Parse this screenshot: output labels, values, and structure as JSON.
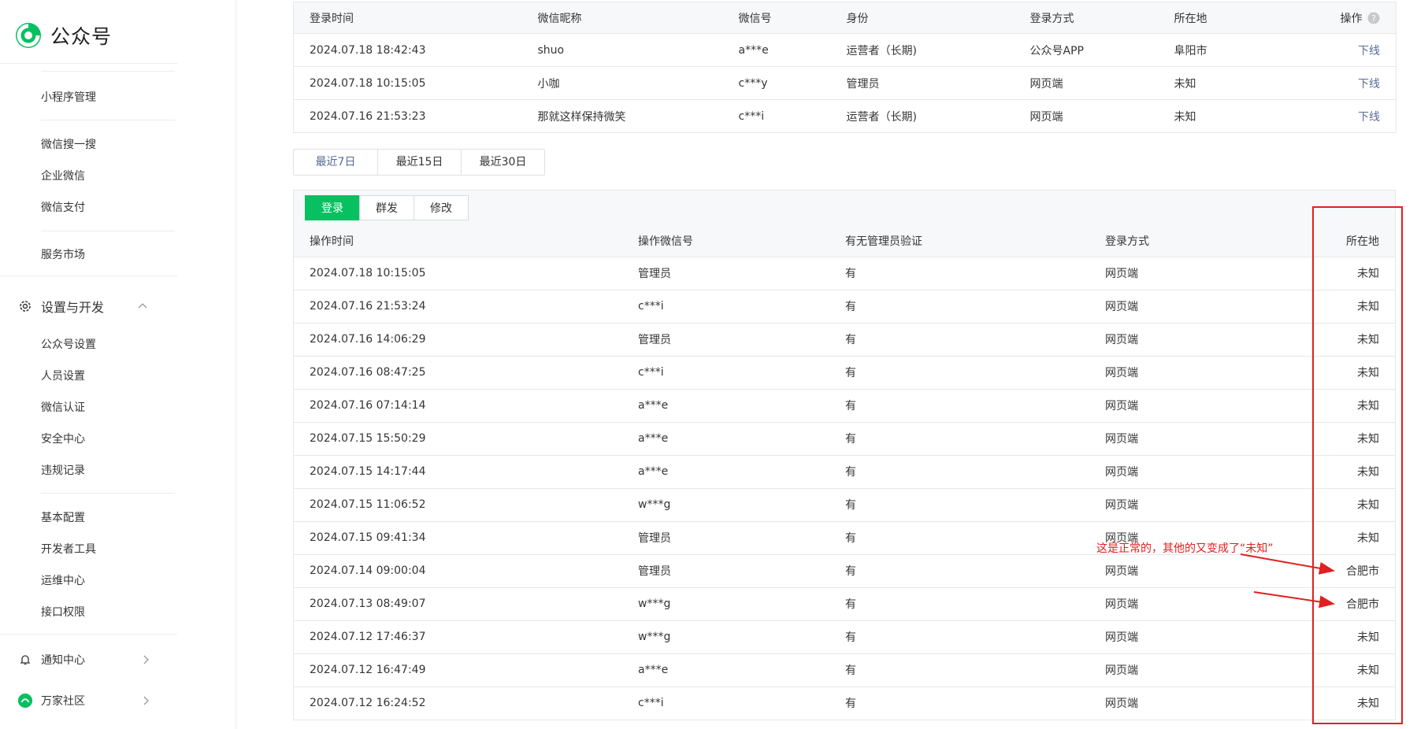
{
  "brand": {
    "title": "公众号"
  },
  "sidebar": {
    "items": [
      "小程序管理",
      "微信搜一搜",
      "企业微信",
      "微信支付",
      "服务市场"
    ],
    "settings": {
      "label": "设置与开发",
      "sub": [
        "公众号设置",
        "人员设置",
        "微信认证",
        "安全中心",
        "违规记录"
      ],
      "sub2": [
        "基本配置",
        "开发者工具",
        "运维中心",
        "接口权限"
      ]
    },
    "notify": "通知中心",
    "community": "万家社区"
  },
  "login_table": {
    "headers": [
      "登录时间",
      "微信昵称",
      "微信号",
      "身份",
      "登录方式",
      "所在地",
      "操作"
    ],
    "rows": [
      [
        "2024.07.18 18:42:43",
        "shuo",
        "a***e",
        "运营者（长期)",
        "公众号APP",
        "阜阳市",
        "下线"
      ],
      [
        "2024.07.18 10:15:05",
        "小咖",
        "c***y",
        "管理员",
        "网页端",
        "未知",
        "下线"
      ],
      [
        "2024.07.16 21:53:23",
        "那就这样保持微笑",
        "c***i",
        "运营者（长期)",
        "网页端",
        "未知",
        "下线"
      ]
    ]
  },
  "range_buttons": [
    "最近7日",
    "最近15日",
    "最近30日"
  ],
  "tabs": [
    "登录",
    "群发",
    "修改"
  ],
  "log_table": {
    "headers": [
      "操作时间",
      "操作微信号",
      "有无管理员验证",
      "登录方式",
      "所在地"
    ],
    "rows": [
      [
        "2024.07.18 10:15:05",
        "管理员",
        "有",
        "网页端",
        "未知"
      ],
      [
        "2024.07.16 21:53:24",
        "c***i",
        "有",
        "网页端",
        "未知"
      ],
      [
        "2024.07.16 14:06:29",
        "管理员",
        "有",
        "网页端",
        "未知"
      ],
      [
        "2024.07.16 08:47:25",
        "c***i",
        "有",
        "网页端",
        "未知"
      ],
      [
        "2024.07.16 07:14:14",
        "a***e",
        "有",
        "网页端",
        "未知"
      ],
      [
        "2024.07.15 15:50:29",
        "a***e",
        "有",
        "网页端",
        "未知"
      ],
      [
        "2024.07.15 14:17:44",
        "a***e",
        "有",
        "网页端",
        "未知"
      ],
      [
        "2024.07.15 11:06:52",
        "w***g",
        "有",
        "网页端",
        "未知"
      ],
      [
        "2024.07.15 09:41:34",
        "管理员",
        "有",
        "网页端",
        "未知"
      ],
      [
        "2024.07.14 09:00:04",
        "管理员",
        "有",
        "网页端",
        "合肥市"
      ],
      [
        "2024.07.13 08:49:07",
        "w***g",
        "有",
        "网页端",
        "合肥市"
      ],
      [
        "2024.07.12 17:46:37",
        "w***g",
        "有",
        "网页端",
        "未知"
      ],
      [
        "2024.07.12 16:47:49",
        "a***e",
        "有",
        "网页端",
        "未知"
      ],
      [
        "2024.07.12 16:24:52",
        "c***i",
        "有",
        "网页端",
        "未知"
      ]
    ]
  },
  "annotation": "这是正常的，其他的又变成了“未知”",
  "colors": {
    "accent": "#07c160",
    "link": "#576b95",
    "highlight": "#e02020"
  }
}
